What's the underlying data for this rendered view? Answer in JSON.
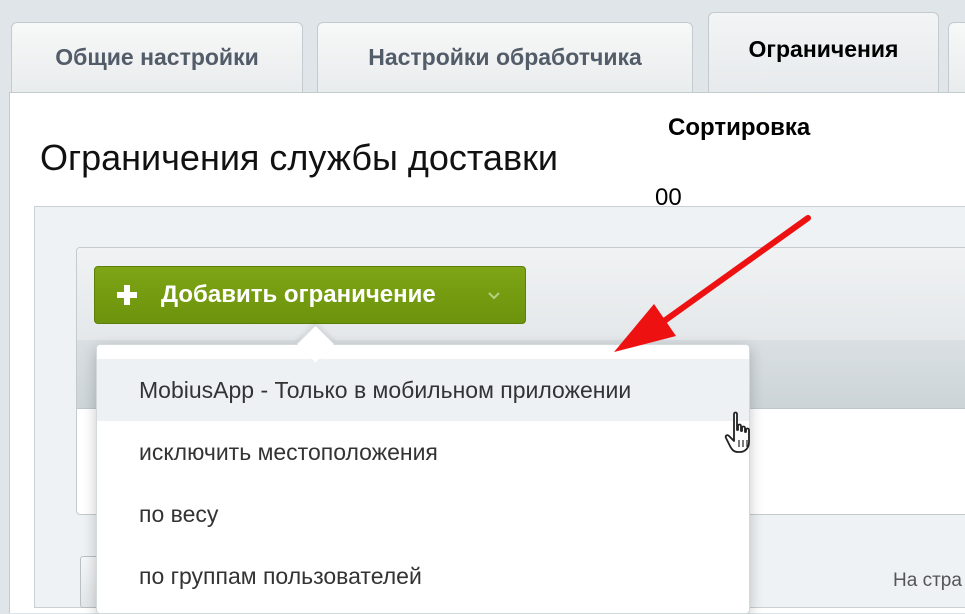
{
  "tabs": [
    {
      "label": "Общие настройки",
      "active": false
    },
    {
      "label": "Настройки обработчика",
      "active": false
    },
    {
      "label": "Ограничения",
      "active": true
    }
  ],
  "page": {
    "title": "Ограничения службы доставки"
  },
  "toolbar": {
    "add_label": "Добавить ограничение",
    "add_icon": "plus-icon",
    "menu_icon": "chevron-down-icon"
  },
  "grid": {
    "sort_header": "Сортировка",
    "row_value": "00"
  },
  "dropdown": {
    "items": [
      "MobiusApp - Только в мобильном приложении",
      "исключить местоположения",
      "по весу",
      "по группам пользователей"
    ]
  },
  "pager": {
    "label": "На стра"
  },
  "colors": {
    "accent_green": "#76a010",
    "annotation_arrow": "#ee1111"
  }
}
